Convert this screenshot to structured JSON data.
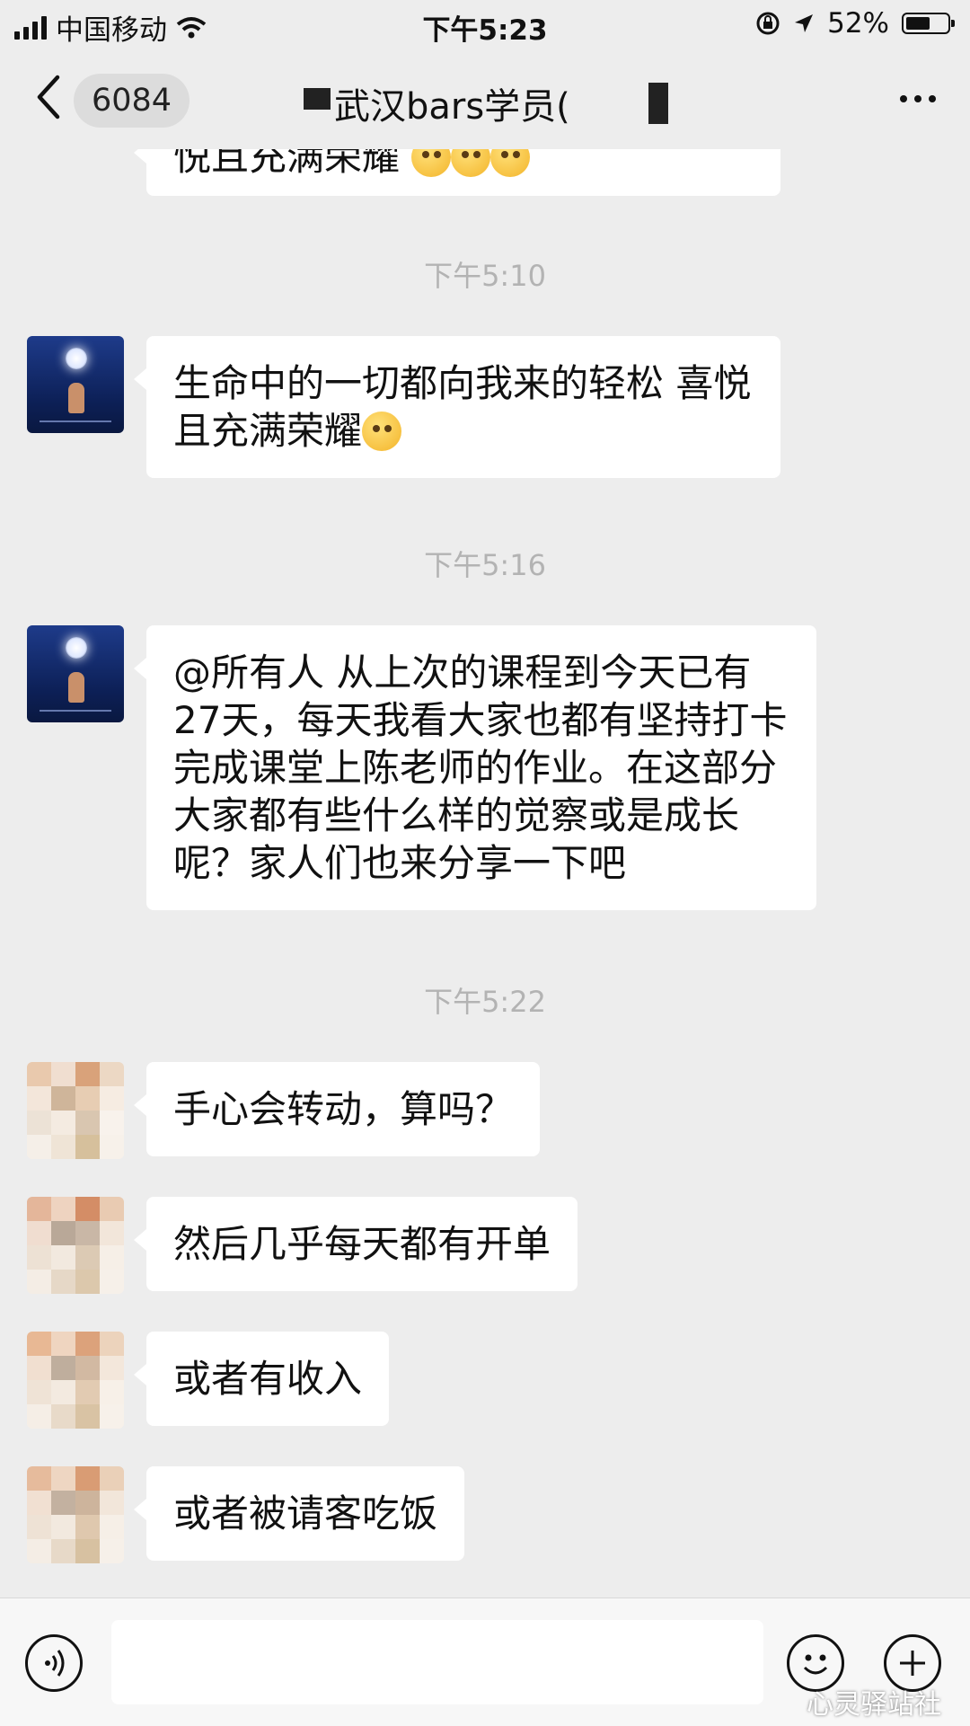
{
  "status_bar": {
    "carrier": "中国移动",
    "time": "下午5:23",
    "battery": "52%"
  },
  "nav": {
    "unread_count": "6084",
    "title": "武汉bars学员("
  },
  "messages": [
    {
      "type": "partial",
      "text": "悦且充满荣耀"
    },
    {
      "type": "time",
      "text": "下午5:10"
    },
    {
      "type": "msg",
      "avatar": "moon",
      "text": "生命中的一切都向我来的轻松 喜悦且充满荣耀"
    },
    {
      "type": "time",
      "text": "下午5:16"
    },
    {
      "type": "msg",
      "avatar": "moon",
      "text": "@所有人 从上次的课程到今天已有27天，每天我看大家也都有坚持打卡完成课堂上陈老师的作业。在这部分大家都有些什么样的觉察或是成长呢？家人们也来分享一下吧"
    },
    {
      "type": "time",
      "text": "下午5:22"
    },
    {
      "type": "msg",
      "avatar": "pixel",
      "text": "手心会转动，算吗？"
    },
    {
      "type": "msg",
      "avatar": "pixel",
      "text": "然后几乎每天都有开单"
    },
    {
      "type": "msg",
      "avatar": "pixel",
      "text": "或者有收入"
    },
    {
      "type": "msg",
      "avatar": "pixel",
      "text": "或者被请客吃饭"
    }
  ],
  "input": {
    "placeholder": ""
  },
  "watermark": "心灵驿站社",
  "icons": {
    "signal": "signal-icon",
    "wifi": "wifi-icon",
    "lock": "orientation-lock-icon",
    "location": "location-arrow-icon",
    "back": "chevron-left-icon",
    "more": "more-dots-icon",
    "voice": "voice-icon",
    "emoji": "emoji-icon",
    "plus": "plus-icon"
  }
}
